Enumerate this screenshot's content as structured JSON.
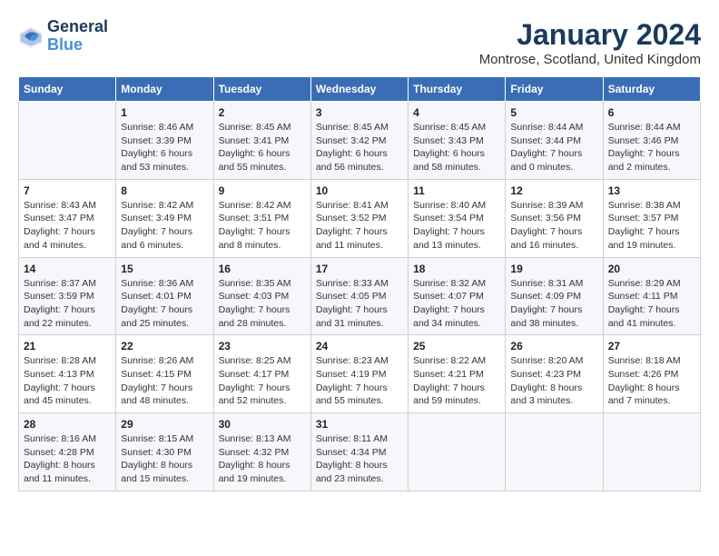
{
  "header": {
    "logo_line1": "General",
    "logo_line2": "Blue",
    "month_title": "January 2024",
    "location": "Montrose, Scotland, United Kingdom"
  },
  "weekdays": [
    "Sunday",
    "Monday",
    "Tuesday",
    "Wednesday",
    "Thursday",
    "Friday",
    "Saturday"
  ],
  "weeks": [
    [
      {
        "day": "",
        "sunrise": "",
        "sunset": "",
        "daylight": ""
      },
      {
        "day": "1",
        "sunrise": "Sunrise: 8:46 AM",
        "sunset": "Sunset: 3:39 PM",
        "daylight": "Daylight: 6 hours and 53 minutes."
      },
      {
        "day": "2",
        "sunrise": "Sunrise: 8:45 AM",
        "sunset": "Sunset: 3:41 PM",
        "daylight": "Daylight: 6 hours and 55 minutes."
      },
      {
        "day": "3",
        "sunrise": "Sunrise: 8:45 AM",
        "sunset": "Sunset: 3:42 PM",
        "daylight": "Daylight: 6 hours and 56 minutes."
      },
      {
        "day": "4",
        "sunrise": "Sunrise: 8:45 AM",
        "sunset": "Sunset: 3:43 PM",
        "daylight": "Daylight: 6 hours and 58 minutes."
      },
      {
        "day": "5",
        "sunrise": "Sunrise: 8:44 AM",
        "sunset": "Sunset: 3:44 PM",
        "daylight": "Daylight: 7 hours and 0 minutes."
      },
      {
        "day": "6",
        "sunrise": "Sunrise: 8:44 AM",
        "sunset": "Sunset: 3:46 PM",
        "daylight": "Daylight: 7 hours and 2 minutes."
      }
    ],
    [
      {
        "day": "7",
        "sunrise": "Sunrise: 8:43 AM",
        "sunset": "Sunset: 3:47 PM",
        "daylight": "Daylight: 7 hours and 4 minutes."
      },
      {
        "day": "8",
        "sunrise": "Sunrise: 8:42 AM",
        "sunset": "Sunset: 3:49 PM",
        "daylight": "Daylight: 7 hours and 6 minutes."
      },
      {
        "day": "9",
        "sunrise": "Sunrise: 8:42 AM",
        "sunset": "Sunset: 3:51 PM",
        "daylight": "Daylight: 7 hours and 8 minutes."
      },
      {
        "day": "10",
        "sunrise": "Sunrise: 8:41 AM",
        "sunset": "Sunset: 3:52 PM",
        "daylight": "Daylight: 7 hours and 11 minutes."
      },
      {
        "day": "11",
        "sunrise": "Sunrise: 8:40 AM",
        "sunset": "Sunset: 3:54 PM",
        "daylight": "Daylight: 7 hours and 13 minutes."
      },
      {
        "day": "12",
        "sunrise": "Sunrise: 8:39 AM",
        "sunset": "Sunset: 3:56 PM",
        "daylight": "Daylight: 7 hours and 16 minutes."
      },
      {
        "day": "13",
        "sunrise": "Sunrise: 8:38 AM",
        "sunset": "Sunset: 3:57 PM",
        "daylight": "Daylight: 7 hours and 19 minutes."
      }
    ],
    [
      {
        "day": "14",
        "sunrise": "Sunrise: 8:37 AM",
        "sunset": "Sunset: 3:59 PM",
        "daylight": "Daylight: 7 hours and 22 minutes."
      },
      {
        "day": "15",
        "sunrise": "Sunrise: 8:36 AM",
        "sunset": "Sunset: 4:01 PM",
        "daylight": "Daylight: 7 hours and 25 minutes."
      },
      {
        "day": "16",
        "sunrise": "Sunrise: 8:35 AM",
        "sunset": "Sunset: 4:03 PM",
        "daylight": "Daylight: 7 hours and 28 minutes."
      },
      {
        "day": "17",
        "sunrise": "Sunrise: 8:33 AM",
        "sunset": "Sunset: 4:05 PM",
        "daylight": "Daylight: 7 hours and 31 minutes."
      },
      {
        "day": "18",
        "sunrise": "Sunrise: 8:32 AM",
        "sunset": "Sunset: 4:07 PM",
        "daylight": "Daylight: 7 hours and 34 minutes."
      },
      {
        "day": "19",
        "sunrise": "Sunrise: 8:31 AM",
        "sunset": "Sunset: 4:09 PM",
        "daylight": "Daylight: 7 hours and 38 minutes."
      },
      {
        "day": "20",
        "sunrise": "Sunrise: 8:29 AM",
        "sunset": "Sunset: 4:11 PM",
        "daylight": "Daylight: 7 hours and 41 minutes."
      }
    ],
    [
      {
        "day": "21",
        "sunrise": "Sunrise: 8:28 AM",
        "sunset": "Sunset: 4:13 PM",
        "daylight": "Daylight: 7 hours and 45 minutes."
      },
      {
        "day": "22",
        "sunrise": "Sunrise: 8:26 AM",
        "sunset": "Sunset: 4:15 PM",
        "daylight": "Daylight: 7 hours and 48 minutes."
      },
      {
        "day": "23",
        "sunrise": "Sunrise: 8:25 AM",
        "sunset": "Sunset: 4:17 PM",
        "daylight": "Daylight: 7 hours and 52 minutes."
      },
      {
        "day": "24",
        "sunrise": "Sunrise: 8:23 AM",
        "sunset": "Sunset: 4:19 PM",
        "daylight": "Daylight: 7 hours and 55 minutes."
      },
      {
        "day": "25",
        "sunrise": "Sunrise: 8:22 AM",
        "sunset": "Sunset: 4:21 PM",
        "daylight": "Daylight: 7 hours and 59 minutes."
      },
      {
        "day": "26",
        "sunrise": "Sunrise: 8:20 AM",
        "sunset": "Sunset: 4:23 PM",
        "daylight": "Daylight: 8 hours and 3 minutes."
      },
      {
        "day": "27",
        "sunrise": "Sunrise: 8:18 AM",
        "sunset": "Sunset: 4:26 PM",
        "daylight": "Daylight: 8 hours and 7 minutes."
      }
    ],
    [
      {
        "day": "28",
        "sunrise": "Sunrise: 8:16 AM",
        "sunset": "Sunset: 4:28 PM",
        "daylight": "Daylight: 8 hours and 11 minutes."
      },
      {
        "day": "29",
        "sunrise": "Sunrise: 8:15 AM",
        "sunset": "Sunset: 4:30 PM",
        "daylight": "Daylight: 8 hours and 15 minutes."
      },
      {
        "day": "30",
        "sunrise": "Sunrise: 8:13 AM",
        "sunset": "Sunset: 4:32 PM",
        "daylight": "Daylight: 8 hours and 19 minutes."
      },
      {
        "day": "31",
        "sunrise": "Sunrise: 8:11 AM",
        "sunset": "Sunset: 4:34 PM",
        "daylight": "Daylight: 8 hours and 23 minutes."
      },
      {
        "day": "",
        "sunrise": "",
        "sunset": "",
        "daylight": ""
      },
      {
        "day": "",
        "sunrise": "",
        "sunset": "",
        "daylight": ""
      },
      {
        "day": "",
        "sunrise": "",
        "sunset": "",
        "daylight": ""
      }
    ]
  ]
}
